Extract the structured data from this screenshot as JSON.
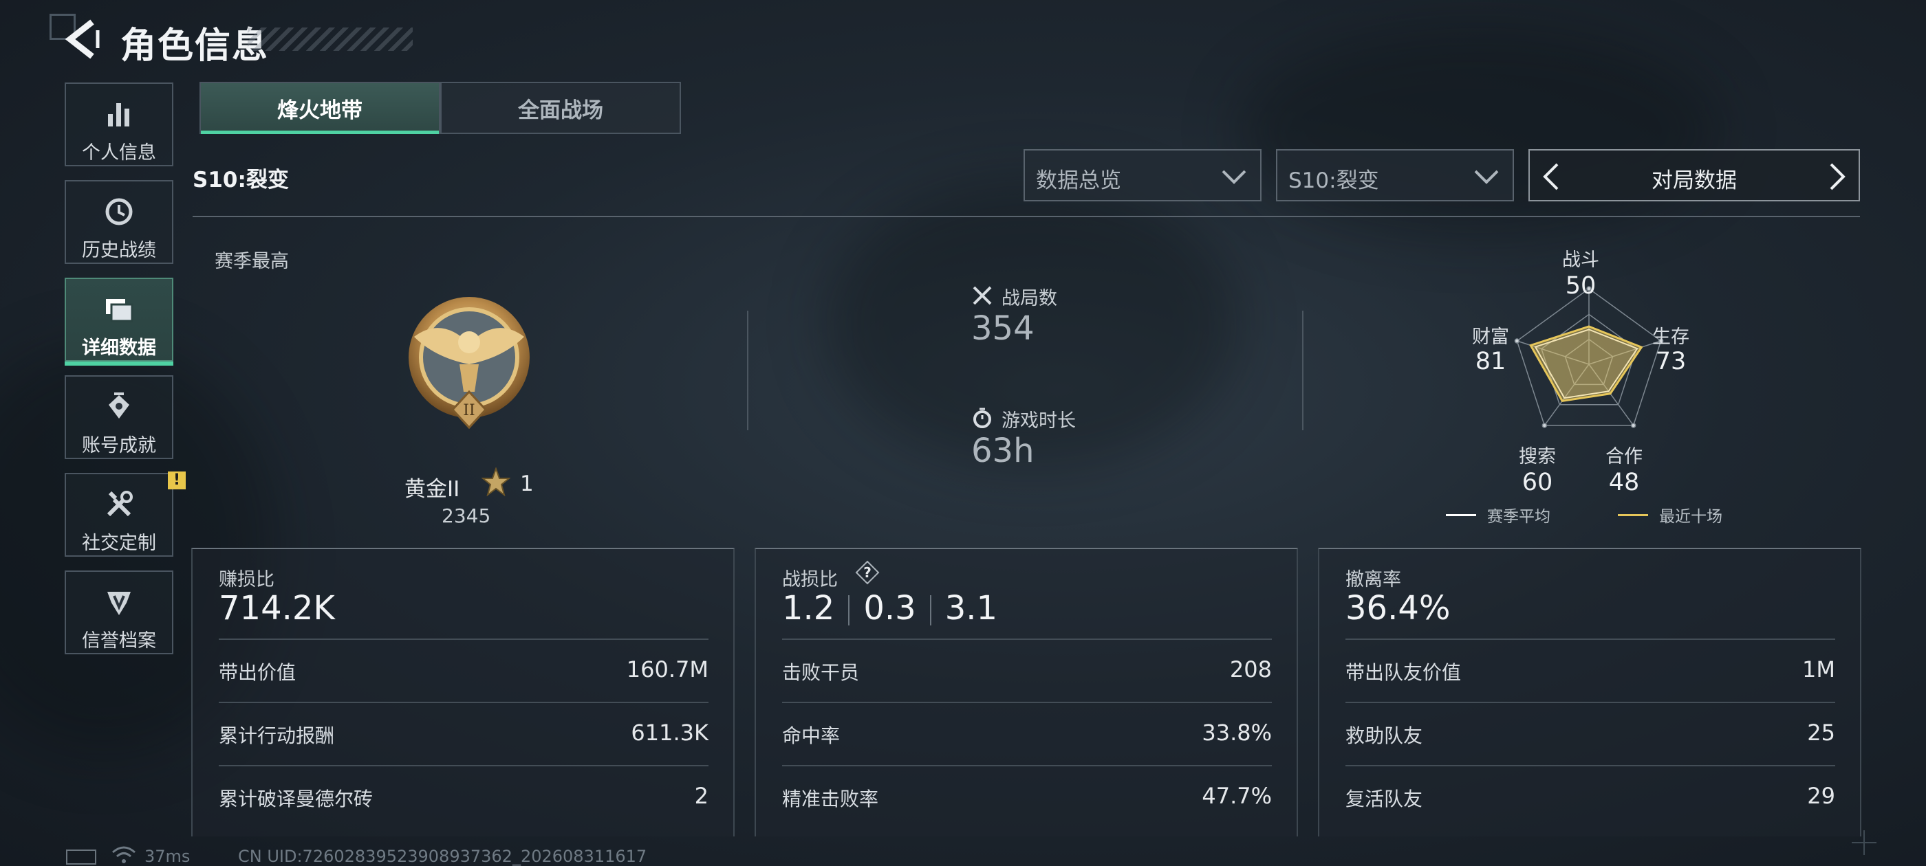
{
  "header": {
    "title": "角色信息"
  },
  "sidebar": {
    "items": [
      {
        "label": "个人信息",
        "icon": "bar-chart-icon"
      },
      {
        "label": "历史战绩",
        "icon": "history-icon"
      },
      {
        "label": "详细数据",
        "icon": "cards-icon",
        "active": true
      },
      {
        "label": "账号成就",
        "icon": "achievement-icon"
      },
      {
        "label": "社交定制",
        "icon": "tools-icon",
        "badge": "!"
      },
      {
        "label": "信誉档案",
        "icon": "credit-icon"
      }
    ]
  },
  "tabs": [
    {
      "label": "烽火地带",
      "active": true
    },
    {
      "label": "全面战场",
      "active": false
    }
  ],
  "season_label": "S10:裂变",
  "filters": {
    "data_type": "数据总览",
    "season": "S10:裂变",
    "pager_label": "对局数据"
  },
  "season_best": {
    "title": "赛季最高",
    "rank": "黄金II",
    "stars": "1",
    "score": "2345"
  },
  "stats": {
    "matches": {
      "label": "战局数",
      "value": "354"
    },
    "playtime": {
      "label": "游戏时长",
      "value": "63h"
    }
  },
  "radar": {
    "axes": [
      {
        "label": "战斗",
        "value": "50"
      },
      {
        "label": "生存",
        "value": "73"
      },
      {
        "label": "合作",
        "value": "48"
      },
      {
        "label": "搜索",
        "value": "60"
      },
      {
        "label": "财富",
        "value": "81"
      }
    ],
    "legend": {
      "season_avg": "赛季平均",
      "recent_ten": "最近十场"
    },
    "colors": {
      "season_avg": "#ffffff",
      "recent_ten": "#e6c65a"
    }
  },
  "panels": {
    "profit": {
      "label": "赚损比",
      "value": "714.2K",
      "rows": [
        {
          "k": "带出价值",
          "v": "160.7M"
        },
        {
          "k": "累计行动报酬",
          "v": "611.3K"
        },
        {
          "k": "累计破译曼德尔砖",
          "v": "2"
        }
      ]
    },
    "combat": {
      "label": "战损比",
      "values": [
        "1.2",
        "0.3",
        "3.1"
      ],
      "rows": [
        {
          "k": "击败干员",
          "v": "208"
        },
        {
          "k": "命中率",
          "v": "33.8%"
        },
        {
          "k": "精准击败率",
          "v": "47.7%"
        }
      ]
    },
    "extract": {
      "label": "撤离率",
      "value": "36.4%",
      "rows": [
        {
          "k": "带出队友价值",
          "v": "1M"
        },
        {
          "k": "救助队友",
          "v": "25"
        },
        {
          "k": "复活队友",
          "v": "29"
        }
      ]
    }
  },
  "footer": {
    "ping": "37ms",
    "uid": "CN UID:7260283952390893736​2_202608311617"
  },
  "colors": {
    "accent": "#4fd2a3",
    "gold": "#e6c65a",
    "badge": "#e8c64a"
  }
}
